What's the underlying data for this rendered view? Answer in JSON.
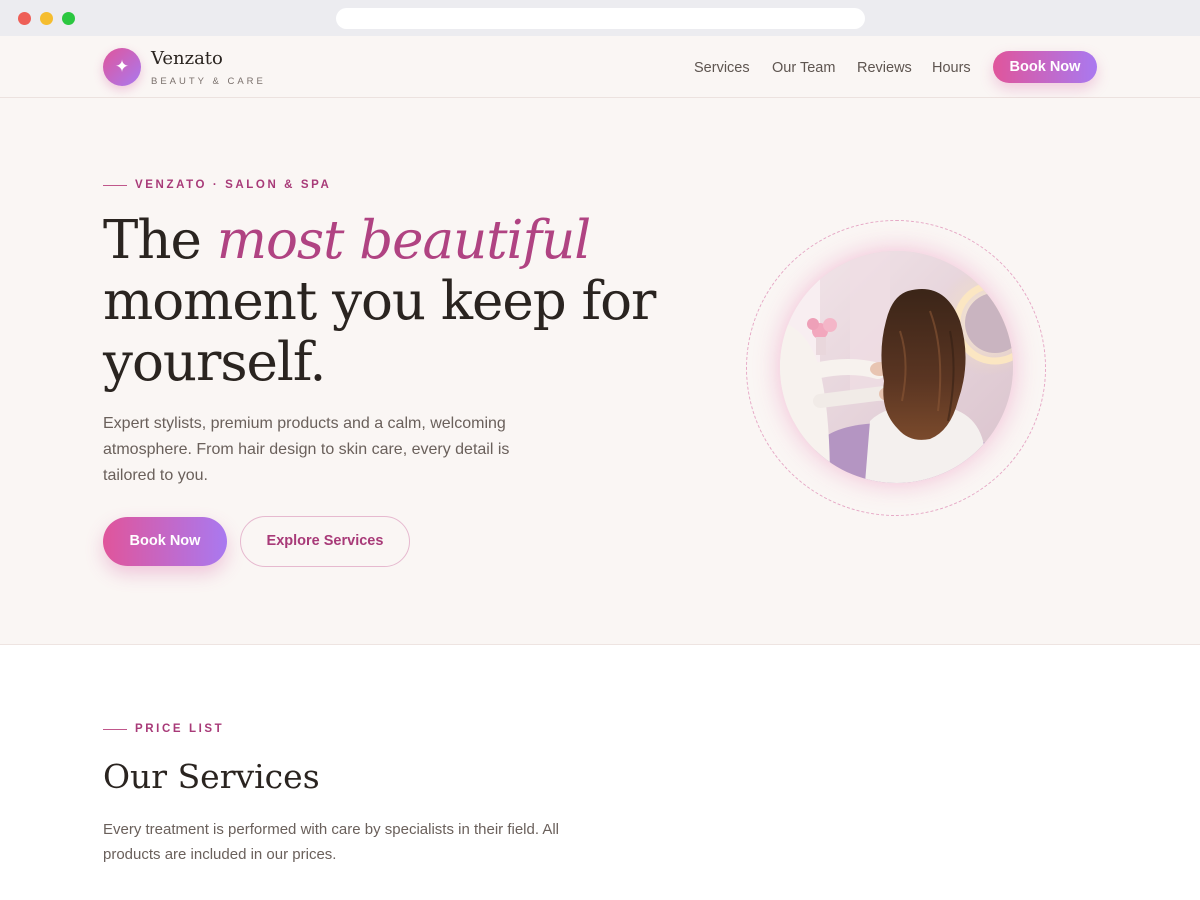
{
  "brand": {
    "name": "Venzato",
    "tagline": "BEAUTY & CARE",
    "logo_icon": "sparkle-icon",
    "logo_glyph": "✦"
  },
  "nav": {
    "items": [
      "Services",
      "Our Team",
      "Reviews",
      "Hours"
    ],
    "cta": "Book Now"
  },
  "hero": {
    "eyebrow": "VENZATO · SALON & SPA",
    "title_start": "The ",
    "title_accent": "most beautiful",
    "title_end": " moment you keep for yourself.",
    "description": "Expert stylists, premium products and a calm, welcoming atmosphere. From hair design to skin care, every detail is tailored to you.",
    "primary_button": "Book Now",
    "secondary_button": "Explore Services"
  },
  "services": {
    "eyebrow": "PRICE LIST",
    "title": "Our Services",
    "description": "Every treatment is performed with care by specialists in their field. All products are included in our prices."
  },
  "colors": {
    "accent": "#b04382",
    "gradient_start": "#e0559b",
    "gradient_end": "#a979f0",
    "hero_background": "#faf6f4"
  }
}
